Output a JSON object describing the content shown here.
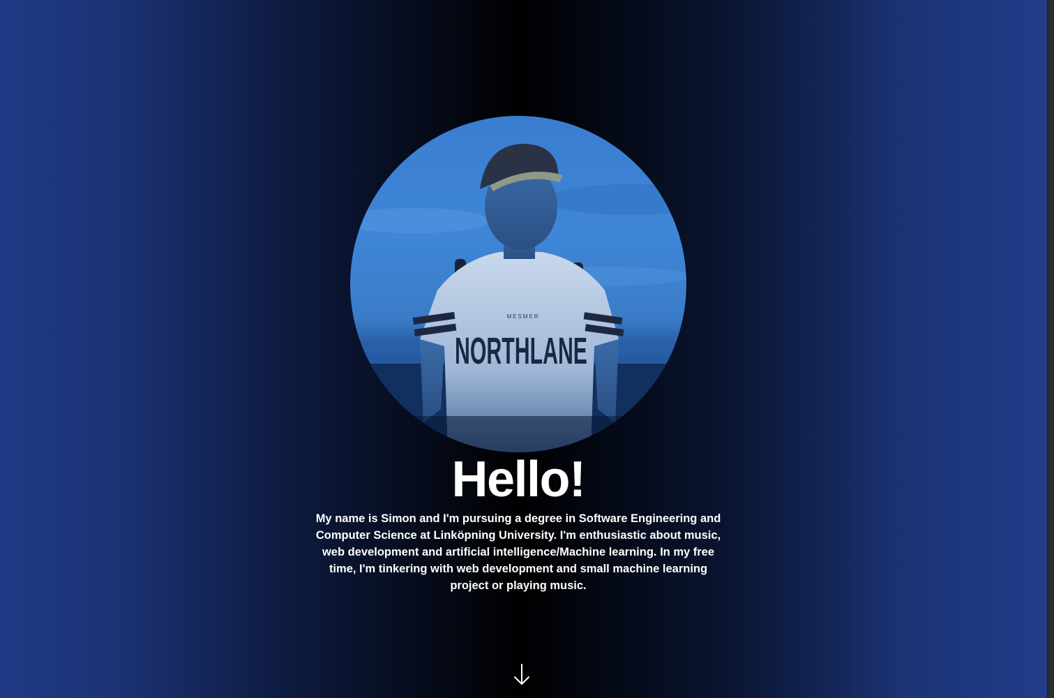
{
  "hero": {
    "greeting": "Hello!",
    "intro": "My name is Simon and I'm pursuing a degree in Software Engineering and Computer Science at Linköpning University. I'm enthusiastic about music, web development and artificial intelligence/Machine learning. In my free time, I'm tinkering with web development and small machine learning project or playing music.",
    "photo": {
      "shirt_text": "NORTHLANE",
      "shirt_subtext": "MESMER"
    },
    "scroll_icon": "arrow-down-icon"
  },
  "colors": {
    "edge_blue": "#213c8a",
    "center_black": "#000000",
    "text": "#ffffff"
  }
}
